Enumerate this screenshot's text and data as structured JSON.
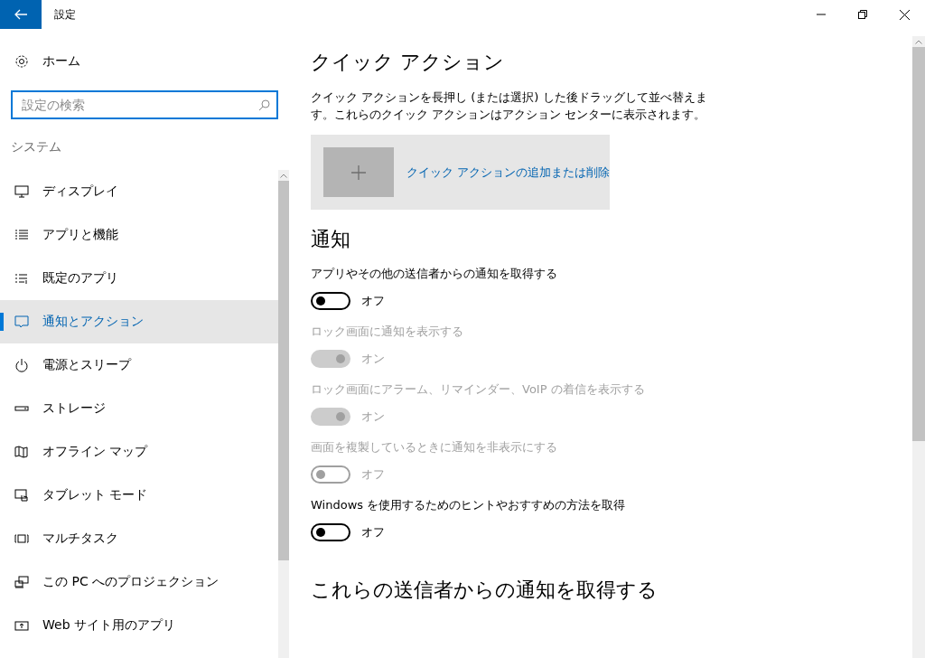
{
  "window": {
    "title": "設定"
  },
  "sidebar": {
    "home": "ホーム",
    "search": {
      "placeholder": "設定の検索"
    },
    "section": "システム",
    "items": [
      {
        "label": "ディスプレイ",
        "selected": false
      },
      {
        "label": "アプリと機能",
        "selected": false
      },
      {
        "label": "既定のアプリ",
        "selected": false
      },
      {
        "label": "通知とアクション",
        "selected": true
      },
      {
        "label": "電源とスリープ",
        "selected": false
      },
      {
        "label": "ストレージ",
        "selected": false
      },
      {
        "label": "オフライン マップ",
        "selected": false
      },
      {
        "label": "タブレット モード",
        "selected": false
      },
      {
        "label": "マルチタスク",
        "selected": false
      },
      {
        "label": "この PC へのプロジェクション",
        "selected": false
      },
      {
        "label": "Web サイト用のアプリ",
        "selected": false
      }
    ]
  },
  "quick_actions": {
    "heading": "クイック アクション",
    "description": "クイック アクションを長押し (または選択) した後ドラッグして並べ替えます。これらのクイック アクションはアクション センターに表示されます。",
    "link": "クイック アクションの追加または削除"
  },
  "notifications": {
    "heading": "通知",
    "settings": [
      {
        "label": "アプリやその他の送信者からの通知を取得する",
        "on": false,
        "disabled": false,
        "state": "オフ"
      },
      {
        "label": "ロック画面に通知を表示する",
        "on": true,
        "disabled": true,
        "state": "オン"
      },
      {
        "label": "ロック画面にアラーム、リマインダー、VoIP の着信を表示する",
        "on": true,
        "disabled": true,
        "state": "オン"
      },
      {
        "label": "画面を複製しているときに通知を非表示にする",
        "on": false,
        "disabled": true,
        "state": "オフ"
      },
      {
        "label": "Windows を使用するためのヒントやおすすめの方法を取得",
        "on": false,
        "disabled": false,
        "state": "オフ"
      }
    ]
  },
  "senders": {
    "heading": "これらの送信者からの通知を取得する"
  }
}
